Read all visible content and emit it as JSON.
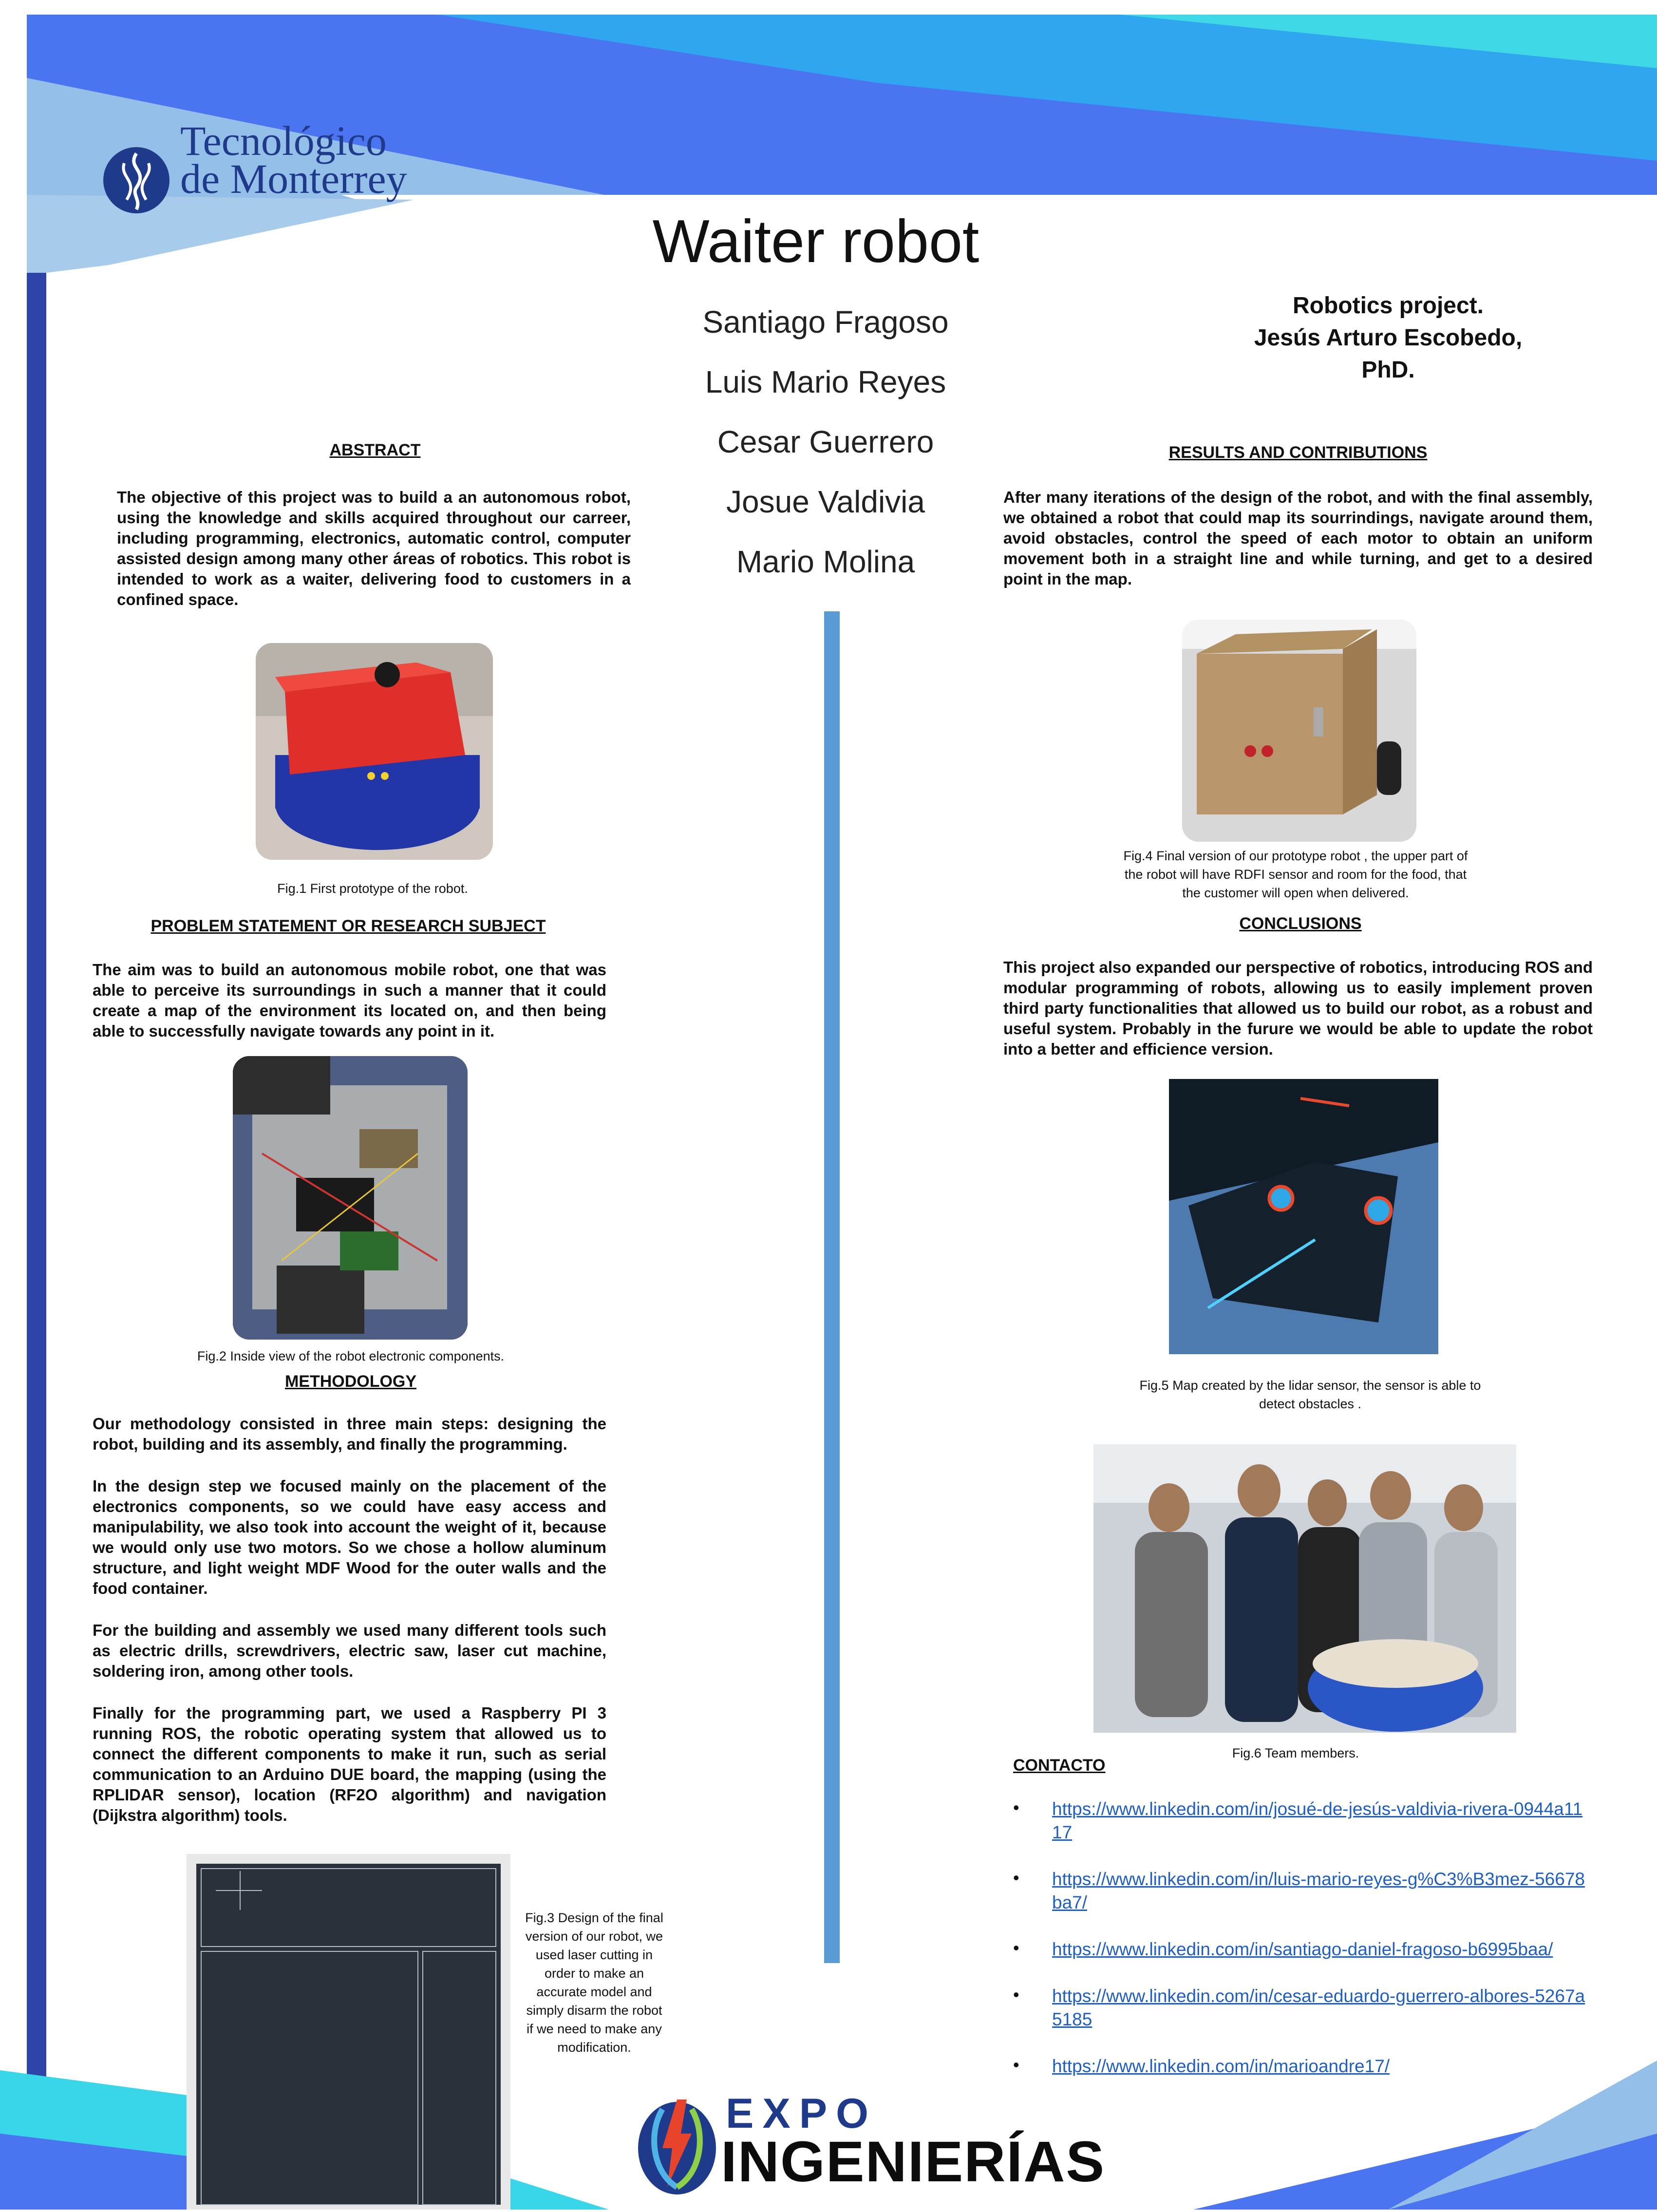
{
  "header": {
    "institution_line1": "Tecnológico",
    "institution_line2": "de Monterrey",
    "title": "Waiter robot",
    "authors": [
      "Santiago Fragoso",
      "Luis Mario Reyes",
      "Cesar Guerrero",
      "Josue Valdivia",
      "Mario Molina"
    ],
    "advisor": [
      "Robotics project.",
      "Jesús Arturo Escobedo,",
      "PhD."
    ]
  },
  "abstract": {
    "heading": "ABSTRACT",
    "text": "The objective of this project was to build a an autonomous robot, using the knowledge and skills acquired throughout our carreer, including programming, electronics, automatic control, computer assisted design among many other áreas of robotics. This robot is intended to work as a waiter, delivering food to customers in a confined space."
  },
  "fig1": {
    "caption": "Fig.1 First prototype of the robot."
  },
  "problem": {
    "heading": "PROBLEM STATEMENT OR RESEARCH SUBJECT",
    "text": "The aim was to build an autonomous mobile robot, one that was able to perceive its surroundings in such a manner that it could create a map of the environment its located on, and then being able to successfully navigate towards any point in it."
  },
  "fig2": {
    "caption": "Fig.2 Inside view of the robot electronic components."
  },
  "methodology": {
    "heading": "METHODOLOGY",
    "paragraphs": [
      "Our methodology consisted in three main steps: designing the robot, building and its assembly, and finally the programming.",
      "In the design step we focused mainly on the placement of the electronics components, so we could have easy access and manipulability, we also took into account the weight of it, because we would only use two motors. So we chose a hollow aluminum structure, and light weight MDF Wood for the outer walls and the food container.",
      "For the building and assembly we used many different tools such as electric drills, screwdrivers, electric saw, laser cut machine, soldering iron, among other tools.",
      "Finally for the programming part, we used a Raspberry PI 3 running ROS, the robotic operating system that allowed us to connect the different components to make it run, such as serial communication to an Arduino DUE board, the mapping (using the RPLIDAR sensor), location (RF2O algorithm) and navigation (Dijkstra algorithm) tools."
    ]
  },
  "fig3": {
    "caption": "Fig.3 Design of the final version of our robot, we used laser cutting in order to make an accurate model and simply disarm the robot if we need to make any modification."
  },
  "results": {
    "heading": "RESULTS AND CONTRIBUTIONS",
    "text": "After many iterations of the design of the robot, and with the final assembly, we obtained a robot that could map its sourrindings, navigate around them, avoid obstacles, control the speed of each motor to obtain an uniform movement both in a straight line and while turning, and get to a desired point in the map."
  },
  "fig4": {
    "caption": "Fig.4 Final version of our prototype robot , the upper part of the robot will have RDFI sensor  and room for the food, that the customer will open when delivered."
  },
  "conclusions": {
    "heading": "CONCLUSIONS",
    "text": "This project also expanded our perspective of robotics, introducing ROS and modular programming of robots, allowing us to easily implement proven third party functionalities that allowed us to build our robot, as a robust and useful system. Probably in the furure we would be able to update the robot into a better and efficience version."
  },
  "fig5": {
    "caption": "Fig.5 Map created by the lidar sensor, the sensor is able to detect obstacles ."
  },
  "fig6": {
    "caption": "Fig.6 Team members."
  },
  "contact": {
    "heading": "CONTACTO",
    "links": [
      "https://www.linkedin.com/in/josué-de-jesús-valdivia-rivera-0944a1117",
      "https://www.linkedin.com/in/luis-mario-reyes-g%C3%B3mez-56678ba7/",
      "https://www.linkedin.com/in/santiago-daniel-fragoso-b6995baa/",
      "https://www.linkedin.com/in/cesar-eduardo-guerrero-albores-5267a5185",
      "https://www.linkedin.com/in/marioandre17/"
    ]
  },
  "footer": {
    "expo_line1": "EXPO",
    "expo_line2": "INGENIERÍAS"
  },
  "colors": {
    "blue_dark": "#3b57d6",
    "blue_light": "#8ec0ea",
    "cyan": "#38d6e8",
    "bar": "#5a9bd5",
    "navy": "#1f3a8a"
  }
}
